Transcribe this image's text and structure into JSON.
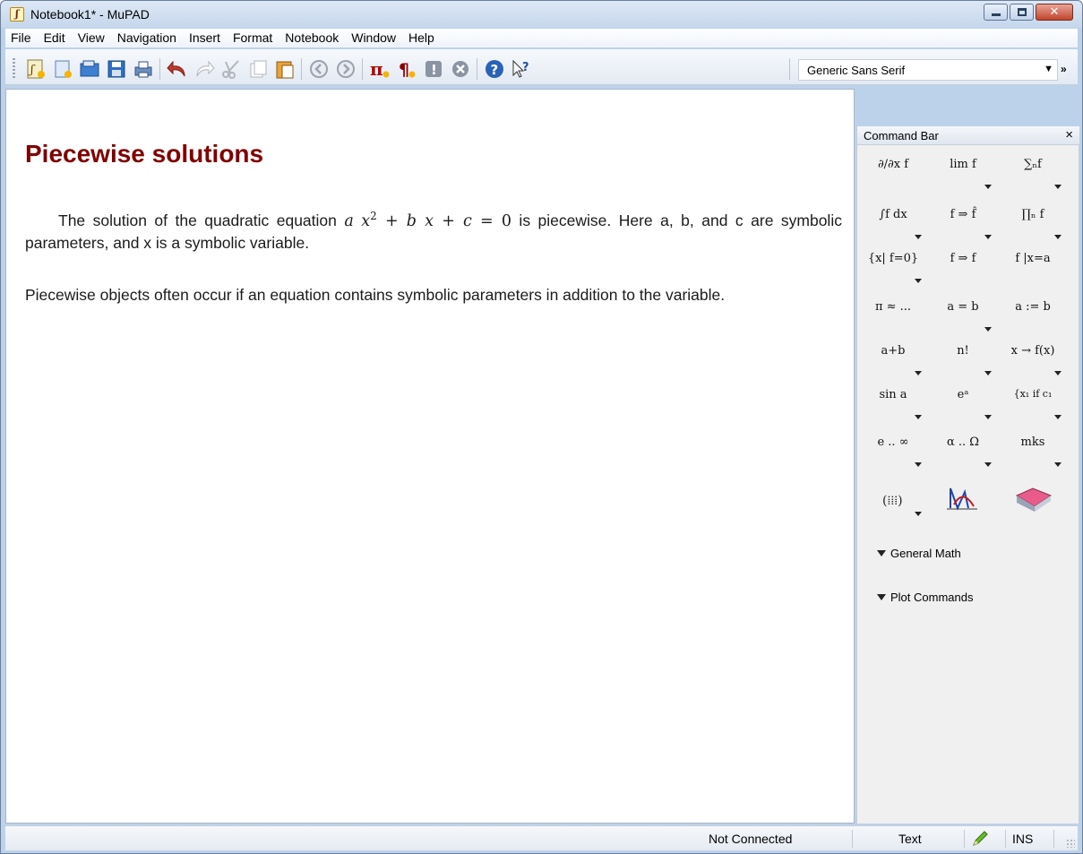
{
  "window": {
    "title": "Notebook1* - MuPAD",
    "app_icon": "mupad-icon"
  },
  "menu": [
    "File",
    "Edit",
    "View",
    "Navigation",
    "Insert",
    "Format",
    "Notebook",
    "Window",
    "Help"
  ],
  "toolbar": {
    "buttons": [
      "new-notebook-icon",
      "new-editor-icon",
      "open-icon",
      "save-icon",
      "print-icon",
      "undo-icon",
      "redo-icon",
      "cut-icon",
      "copy-icon",
      "paste-icon",
      "back-icon",
      "forward-icon",
      "insert-calculation-icon",
      "insert-text-icon",
      "evaluate-icon",
      "stop-icon",
      "help-icon",
      "context-help-icon"
    ],
    "font_value": "Generic Sans Serif",
    "more": "»"
  },
  "document": {
    "title": "Piecewise solutions",
    "p1_before": "The solution of the quadratic equation ",
    "p1_eq_a": "a",
    "p1_eq_x": "x",
    "p1_eq_sup": "2",
    "p1_eq_rest": " + b x + c",
    "p1_eq_eq": " = 0",
    "p1_after": " is piecewise. Here a, b, and c are symbolic parameters, and x is a symbolic variable.",
    "p2": "Piecewise objects often occur if an equation contains symbolic parameters in addition to the variable."
  },
  "command_bar": {
    "title": "Command Bar",
    "close": "×",
    "cells": [
      {
        "label": "∂/∂x f"
      },
      {
        "label": "lim f"
      },
      {
        "label": "∑ₙf"
      },
      {
        "label": "∫f dx"
      },
      {
        "label": "f ⇒ f̂"
      },
      {
        "label": "∏ₙ f"
      },
      {
        "label": "{x| f=0}"
      },
      {
        "label": "f ⇒ f"
      },
      {
        "label": "f |x=a"
      },
      {
        "label": "π ≈ ..."
      },
      {
        "label": "a = b"
      },
      {
        "label": "a := b"
      },
      {
        "label": "a+b"
      },
      {
        "label": "n!"
      },
      {
        "label": "x → f(x)"
      },
      {
        "label": "sin a"
      },
      {
        "label": "eᵃ"
      },
      {
        "label": "{x₁ if c₁"
      },
      {
        "label": "e .. ∞"
      },
      {
        "label": "α .. Ω"
      },
      {
        "label": "mks"
      }
    ],
    "sections": [
      "General Math",
      "Plot Commands"
    ]
  },
  "status": {
    "connection": "Not Connected",
    "mode": "Text",
    "insert": "INS"
  }
}
